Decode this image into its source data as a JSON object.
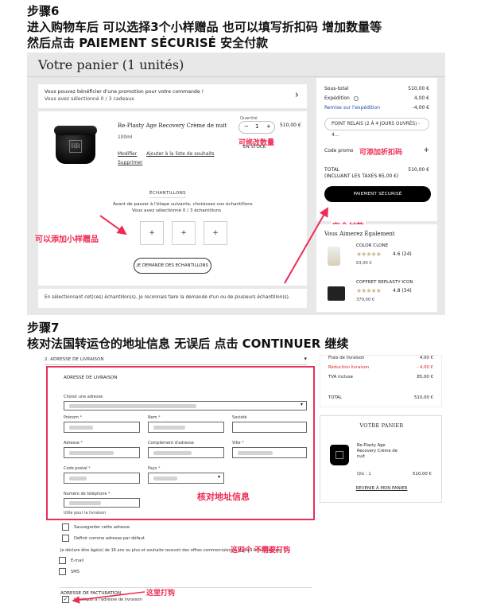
{
  "step6": {
    "title": "步骤6",
    "line1": "进入购物车后  可以选择3个小样赠品  也可以填写折扣码  增加数量等",
    "line2": "然后点击 PAIEMENT SÉCURISÉ 安全付款"
  },
  "cart": {
    "heading": "Votre panier (1 unités)",
    "promo_line1": "Vous pouvez bénéficier d'une promotion pour votre commande !",
    "promo_line2": "Vous avez sélectionné 0 / 3 cadeaux",
    "promo_chevron": "›",
    "product": {
      "name": "Re-Plasty Age Recovery Crème de nuit",
      "size": "100ml",
      "modify": "Modifier",
      "wishlist": "Ajouter à la liste de souhaits",
      "delete": "Supprimer",
      "qty_label": "Quantité",
      "qty_minus": "−",
      "qty_value": "1",
      "qty_plus": "+",
      "price": "510,00 €",
      "stock": "EN STOCK",
      "logo": "HR"
    },
    "samples": {
      "heading": "ÉCHANTILLONS",
      "desc1": "Avant de passer à l'étape suivante, choisissez vos échantillons",
      "desc2": "Vous avez sélectionné 0 / 3 échantillons",
      "plus": "+",
      "button": "JE DEMANDE DES ECHANTILLONS"
    },
    "note": "En sélectionnant cet(ces) échantillon(s), je reconnais faire la demande d'un ou de plusieurs échantillon(s).",
    "summary": {
      "subtotal_label": "Sous-total",
      "subtotal": "510,00 €",
      "shipping_label": "Expédition",
      "shipping": "4,00 €",
      "discount_label": "Remise sur l'expédition",
      "discount": "-4,00 €",
      "relay": "POINT RELAIS (2 À 4 JOURS OUVRÉS) - 4...",
      "promo_label": "Code promo",
      "promo_plus": "+",
      "total_label": "TOTAL",
      "total_taxes": "(INCLUANT LES TAXES 85,00 €)",
      "total": "510,00 €",
      "pay_button": "PAIEMENT SÉCURISÉ"
    },
    "reco": {
      "title": "Vous Aimerez Également",
      "items": [
        {
          "name": "COLOR CLONE",
          "stars": "★★★★★",
          "rating": "4.6 (24)",
          "price": "63,00 €"
        },
        {
          "name": "COFFRET REPLASTY ICON",
          "stars": "★★★★★",
          "rating": "4.8 (34)",
          "price": "379,00 €"
        }
      ]
    },
    "annotations": {
      "qty": "可修改数量",
      "discount": "可添加折扣码",
      "samples": "可以添加小样赠品",
      "pay": "安全付款"
    }
  },
  "step7": {
    "title": "步骤7",
    "line1": "核对法国转运仓的地址信息 无误后 点击 CONTINUER 继续"
  },
  "address": {
    "section_header": "2. ADRESSE DE LIVRAISON",
    "caret": "▾",
    "form_title": "ADRESSE DE LIVRAISON",
    "choose_label": "Choisir une adresse",
    "first_name": "Prénom",
    "last_name": "Nom",
    "company": "Société",
    "address": "Adresse",
    "address2": "Complément d'adresse",
    "city": "Ville",
    "postal": "Code postal",
    "country": "Pays",
    "phone": "Numéro de téléphone",
    "phone_hint": "Utile pour la livraison",
    "req": "*",
    "save_address": "Sauvegarder cette adresse",
    "default_address": "Définir comme adresse par défaut",
    "consent": "Je déclare être âgé(e) de 16 ans ou plus et souhaite recevoir des offres commerciales de Helena Rubinstein par :",
    "email": "E-mail",
    "sms": "SMS",
    "billing_title": "ADRESSE DE FACTURATION",
    "billing_same": "Identique à l'adresse de livraison",
    "check_mark": "✓",
    "annotations": {
      "verify": "核对地址信息",
      "no_tick": "这四个 不需要打钩",
      "tick_here": "这里打钩"
    }
  },
  "addr_summary": {
    "shipping_label": "Frais de livraison",
    "shipping": "4,00 €",
    "reduction_label": "Réduction livraison",
    "reduction": "- 4,00 €",
    "tva_label": "TVA incluse",
    "tva": "85,00 €",
    "total_label": "TOTAL",
    "total": "510,00 €",
    "panier_title": "VOTRE PANIER",
    "item_name": "Re-Plasty Age Recovery Crème de nuit",
    "item_qty": "Qté : 1",
    "item_price": "510,00 €",
    "back_link": "REVENIR À MON PANIER"
  },
  "colors": {
    "annotation_red": "#ee2b52",
    "frame_red": "#e4325a",
    "star": "#c9b88e"
  }
}
